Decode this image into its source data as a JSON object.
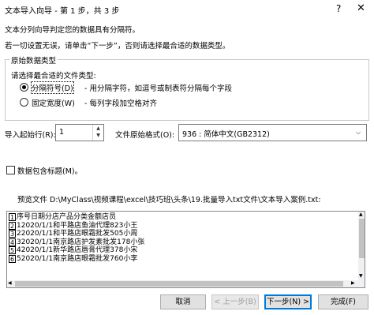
{
  "window": {
    "title": "文本导入向导 - 第 1 步，共 3 步",
    "help_glyph": "?",
    "close_glyph": "✕"
  },
  "intro": {
    "line1": "文本分列向导判定您的数据具有分隔符。",
    "line2": "若一切设置无误，请单击“下一步”，否则请选择最合适的数据类型。"
  },
  "original_data": {
    "group_label": "原始数据类型",
    "prompt": "请选择最合适的文件类型:",
    "options": [
      {
        "label": "分隔符号(D)",
        "desc": "- 用分隔字符，如逗号或制表符分隔每个字段",
        "selected": true
      },
      {
        "label": "固定宽度(W)",
        "desc": "- 每列字段加空格对齐",
        "selected": false
      }
    ]
  },
  "start_row": {
    "label": "导入起始行(R):",
    "value": "1"
  },
  "file_origin": {
    "label": "文件原始格式(O):",
    "value": "936 : 简体中文(GB2312)"
  },
  "headers_checkbox": {
    "label": "数据包含标题(M)。",
    "checked": false
  },
  "preview": {
    "label": "预览文件 D:\\MyClass\\视频课程\\excel\\技巧班\\头条\\19.批量导入txt文件\\文本导入案例.txt:",
    "rows": [
      {
        "num": "1",
        "text": "序号日期分店产品分类金额店员"
      },
      {
        "num": "2",
        "text": "12020/1/1和平路店鱼油代理823小王"
      },
      {
        "num": "3",
        "text": "22020/1/1和平路店眼霜批发505小周"
      },
      {
        "num": "4",
        "text": "32020/1/1南京路店护发素批发178小张"
      },
      {
        "num": "5",
        "text": "42020/1/1新华路店唇膏代理378小宋"
      },
      {
        "num": "6",
        "text": "52020/1/1南京路店眼霜批发760小李"
      }
    ]
  },
  "buttons": {
    "cancel": "取消",
    "back": "< 上一步(B)",
    "next": "下一步(N) >",
    "finish": "完成(F)"
  },
  "icons": {
    "dropdown": "chevron-down-icon",
    "spin_up": "spin-up-icon",
    "spin_down": "spin-down-icon"
  }
}
